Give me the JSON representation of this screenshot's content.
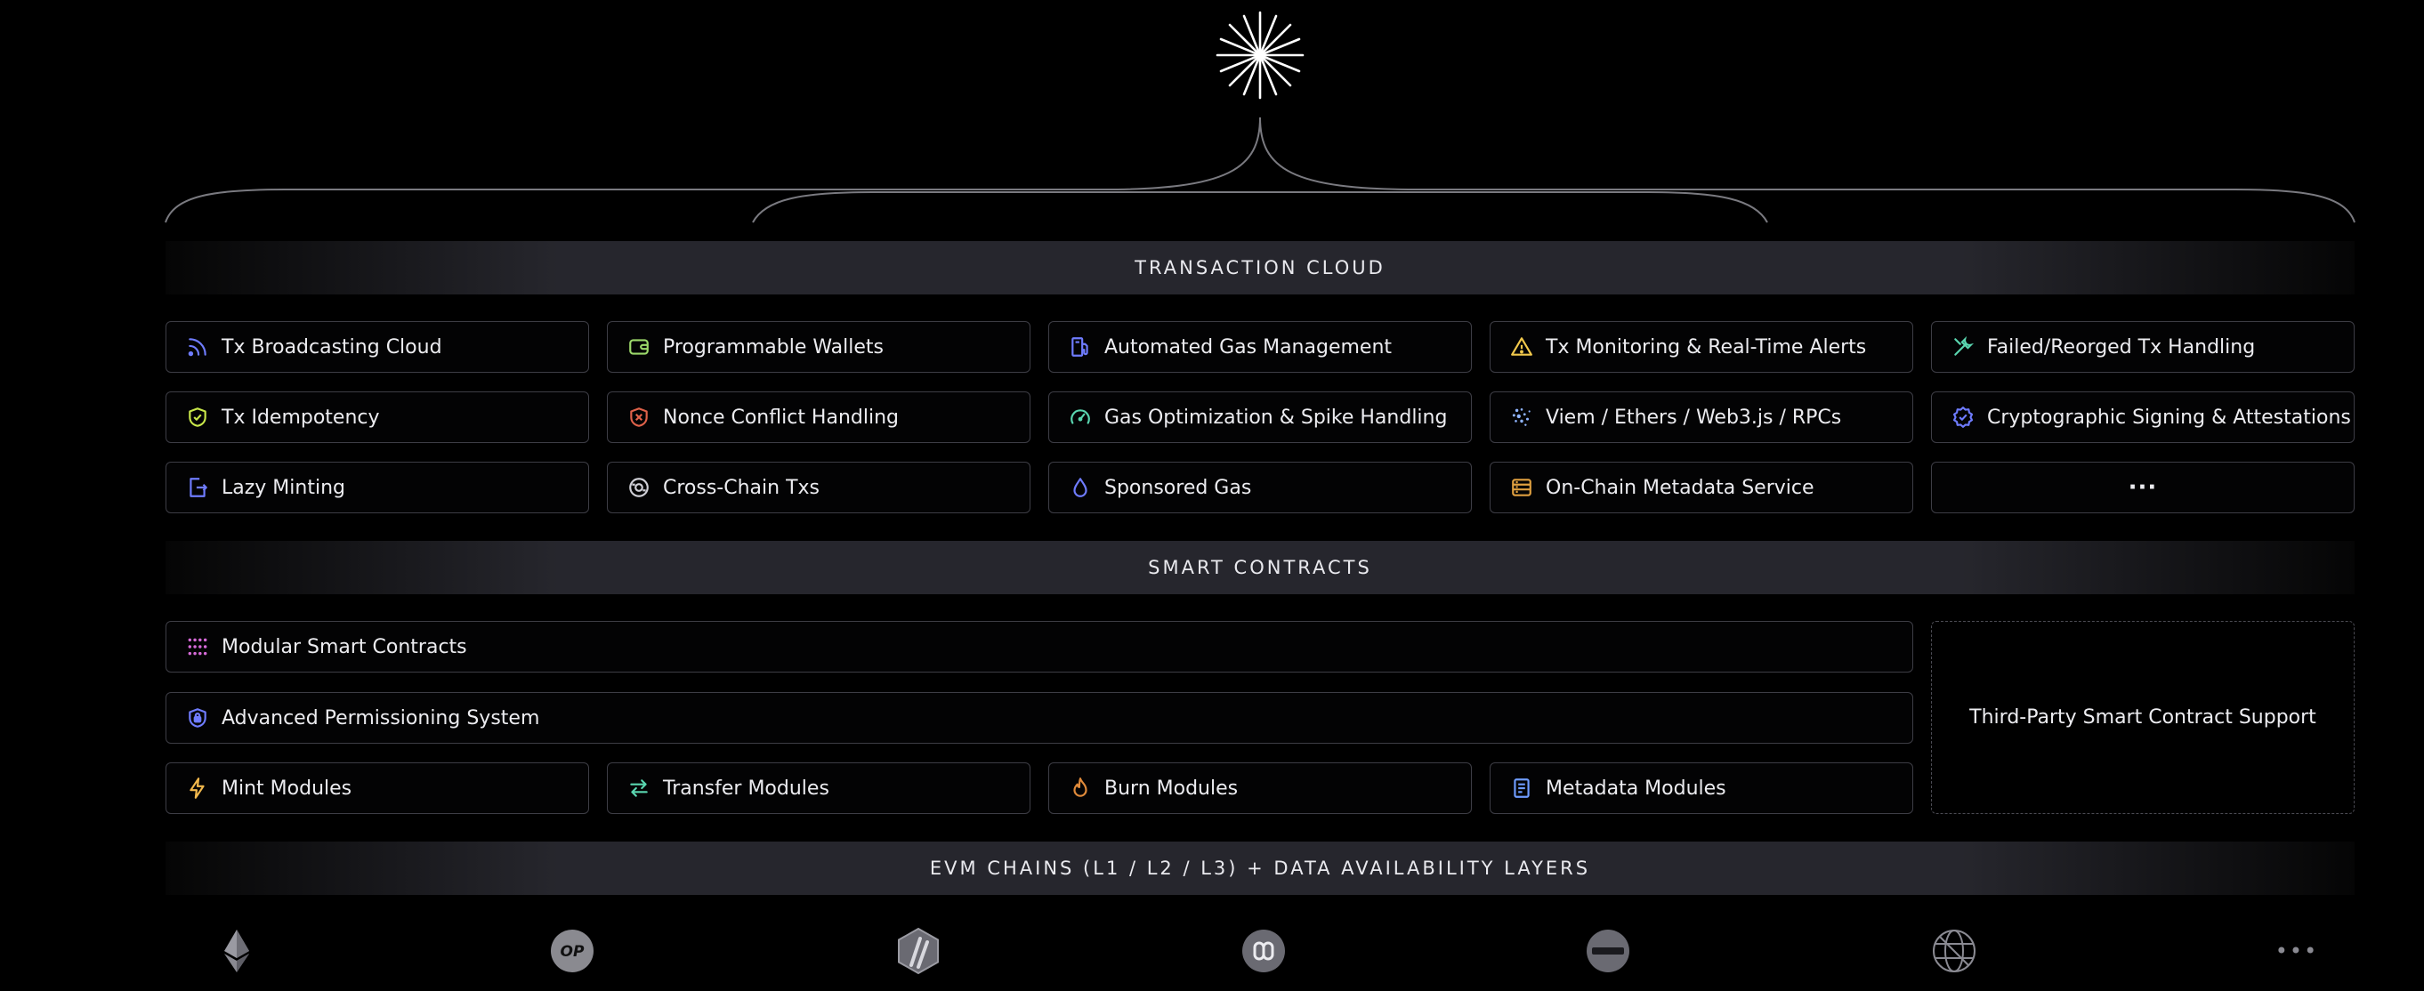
{
  "colors": {
    "background": "#000000",
    "card_border": "#3d3d45",
    "band": "#46464f",
    "text": "#ececf0",
    "accent_blue": "#6f7cff",
    "accent_green": "#9bd86a",
    "accent_orange": "#e08a3a",
    "accent_yellow": "#f2c94c",
    "accent_red": "#e0624a",
    "accent_pink": "#d66ad8",
    "accent_teal": "#5ad6b0"
  },
  "logo": {
    "icon": "starburst-icon"
  },
  "transaction_cloud": {
    "title": "TRANSACTION CLOUD",
    "items": [
      {
        "label": "Tx Broadcasting Cloud",
        "icon": "broadcast-icon"
      },
      {
        "label": "Programmable Wallets",
        "icon": "wallet-icon"
      },
      {
        "label": "Automated Gas Management",
        "icon": "gas-pump-icon"
      },
      {
        "label": "Tx Monitoring & Real-Time Alerts",
        "icon": "alert-triangle-icon"
      },
      {
        "label": "Failed/Reorged Tx Handling",
        "icon": "wrench-icon"
      },
      {
        "label": "Tx Idempotency",
        "icon": "shield-check-icon"
      },
      {
        "label": "Nonce Conflict Handling",
        "icon": "shield-x-icon"
      },
      {
        "label": "Gas Optimization & Spike Handling",
        "icon": "gauge-icon"
      },
      {
        "label": "Viem / Ethers / Web3.js / RPCs",
        "icon": "sparkle-icon"
      },
      {
        "label": "Cryptographic Signing & Attestations",
        "icon": "badge-check-icon"
      },
      {
        "label": "Lazy Minting",
        "icon": "lazy-mint-icon"
      },
      {
        "label": "Cross-Chain Txs",
        "icon": "cross-chain-icon"
      },
      {
        "label": "Sponsored Gas",
        "icon": "droplet-icon"
      },
      {
        "label": "On-Chain Metadata Service",
        "icon": "server-icon"
      },
      {
        "label": "···",
        "icon": "more-dots-icon"
      }
    ]
  },
  "smart_contracts": {
    "title": "SMART CONTRACTS",
    "modular": {
      "label": "Modular Smart Contracts",
      "icon": "grid-dots-icon"
    },
    "permissioning": {
      "label": "Advanced Permissioning System",
      "icon": "lock-shield-icon"
    },
    "third_party": {
      "label": "Third-Party Smart Contract Support"
    },
    "modules": [
      {
        "label": "Mint Modules",
        "icon": "lightning-icon"
      },
      {
        "label": "Transfer Modules",
        "icon": "transfer-arrows-icon"
      },
      {
        "label": "Burn Modules",
        "icon": "flame-icon"
      },
      {
        "label": "Metadata Modules",
        "icon": "document-icon"
      }
    ]
  },
  "evm_chains": {
    "title": "EVM CHAINS (L1 / L2 / L3) + DATA AVAILABILITY LAYERS",
    "chains": [
      {
        "icon": "ethereum-icon"
      },
      {
        "icon": "optimism-icon",
        "text": "OP"
      },
      {
        "icon": "arbitrum-icon"
      },
      {
        "icon": "polygon-icon"
      },
      {
        "icon": "minus-chain-icon"
      },
      {
        "icon": "globe-chain-icon"
      },
      {
        "icon": "more-dots-icon",
        "text": "•••"
      }
    ]
  }
}
